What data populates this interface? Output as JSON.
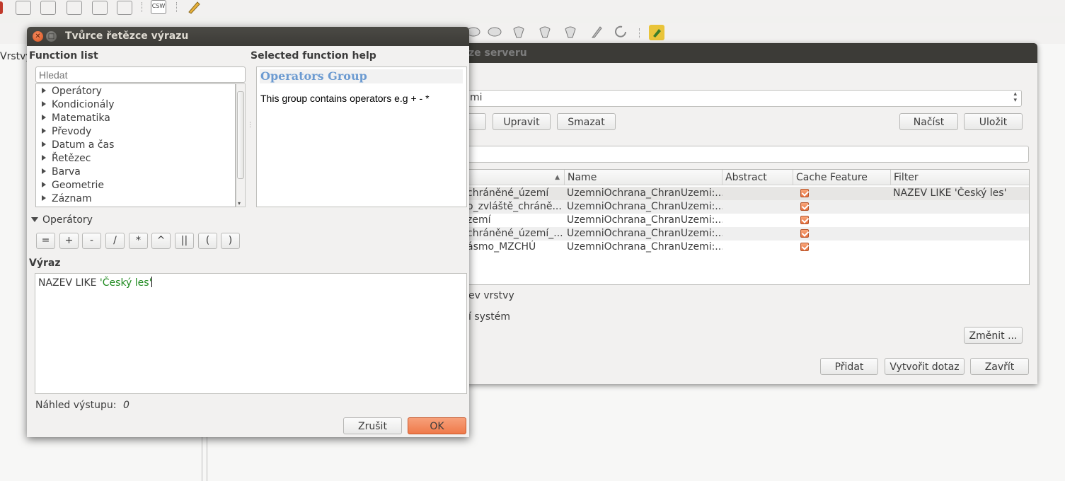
{
  "main": {
    "left_label": "Vrstvy",
    "toolbar_top_csw": "CSW"
  },
  "bg_dialog": {
    "title": "Přidat WFS vrstvu ze serveru",
    "title_visible": "ze serveru",
    "server_combo_text": "mi",
    "buttons": {
      "edit": "Upravit",
      "delete": "Smazat",
      "load": "Načíst",
      "save": "Uložit",
      "change": "Změnit ...",
      "add": "Přidat",
      "build_query": "Vytvořit dotaz",
      "close": "Zavřít"
    },
    "columns": [
      "",
      "Name",
      "Abstract",
      "Cache Feature",
      "Filter"
    ],
    "rows": [
      {
        "title": "chráněné_území",
        "name": "UzemniOchrana_ChranUzemi:...",
        "abstract": "",
        "cache": true,
        "filter": "NAZEV LIKE 'Český les'"
      },
      {
        "title": "o_zvláště_chráně...",
        "name": "UzemniOchrana_ChranUzemi:...",
        "abstract": "",
        "cache": true,
        "filter": ""
      },
      {
        "title": "zemí",
        "name": "UzemniOchrana_ChranUzemi:...",
        "abstract": "",
        "cache": true,
        "filter": ""
      },
      {
        "title": "chráněné_území_...",
        "name": "UzemniOchrana_ChranUzemi:...",
        "abstract": "",
        "cache": true,
        "filter": ""
      },
      {
        "title": "ásmo_MZCHÚ",
        "name": "UzemniOchrana_ChranUzemi:...",
        "abstract": "",
        "cache": true,
        "filter": ""
      }
    ],
    "layer_name_text": "ev vrstvy",
    "crs_text": "í systém"
  },
  "expr_dialog": {
    "title": "Tvůrce řetězce výrazu",
    "function_list_label": "Function list",
    "help_label": "Selected function help",
    "search_placeholder": "Hledat",
    "functions": [
      "Operátory",
      "Kondicionály",
      "Matematika",
      "Převody",
      "Datum a čas",
      "Řetězec",
      "Barva",
      "Geometrie",
      "Záznam"
    ],
    "help_title": "Operators Group",
    "help_text": "This group contains operators e.g + - *",
    "operators_label": "Operátory",
    "operators": [
      "=",
      "+",
      "-",
      "/",
      "*",
      "^",
      "||",
      "(",
      ")"
    ],
    "expression_label": "Výraz",
    "expression_field": "NAZEV LIKE ",
    "expression_string": "'Český les'",
    "preview_label": "Náhled výstupu:",
    "preview_value": "0",
    "cancel_button": "Zrušit",
    "ok_button": "OK"
  }
}
